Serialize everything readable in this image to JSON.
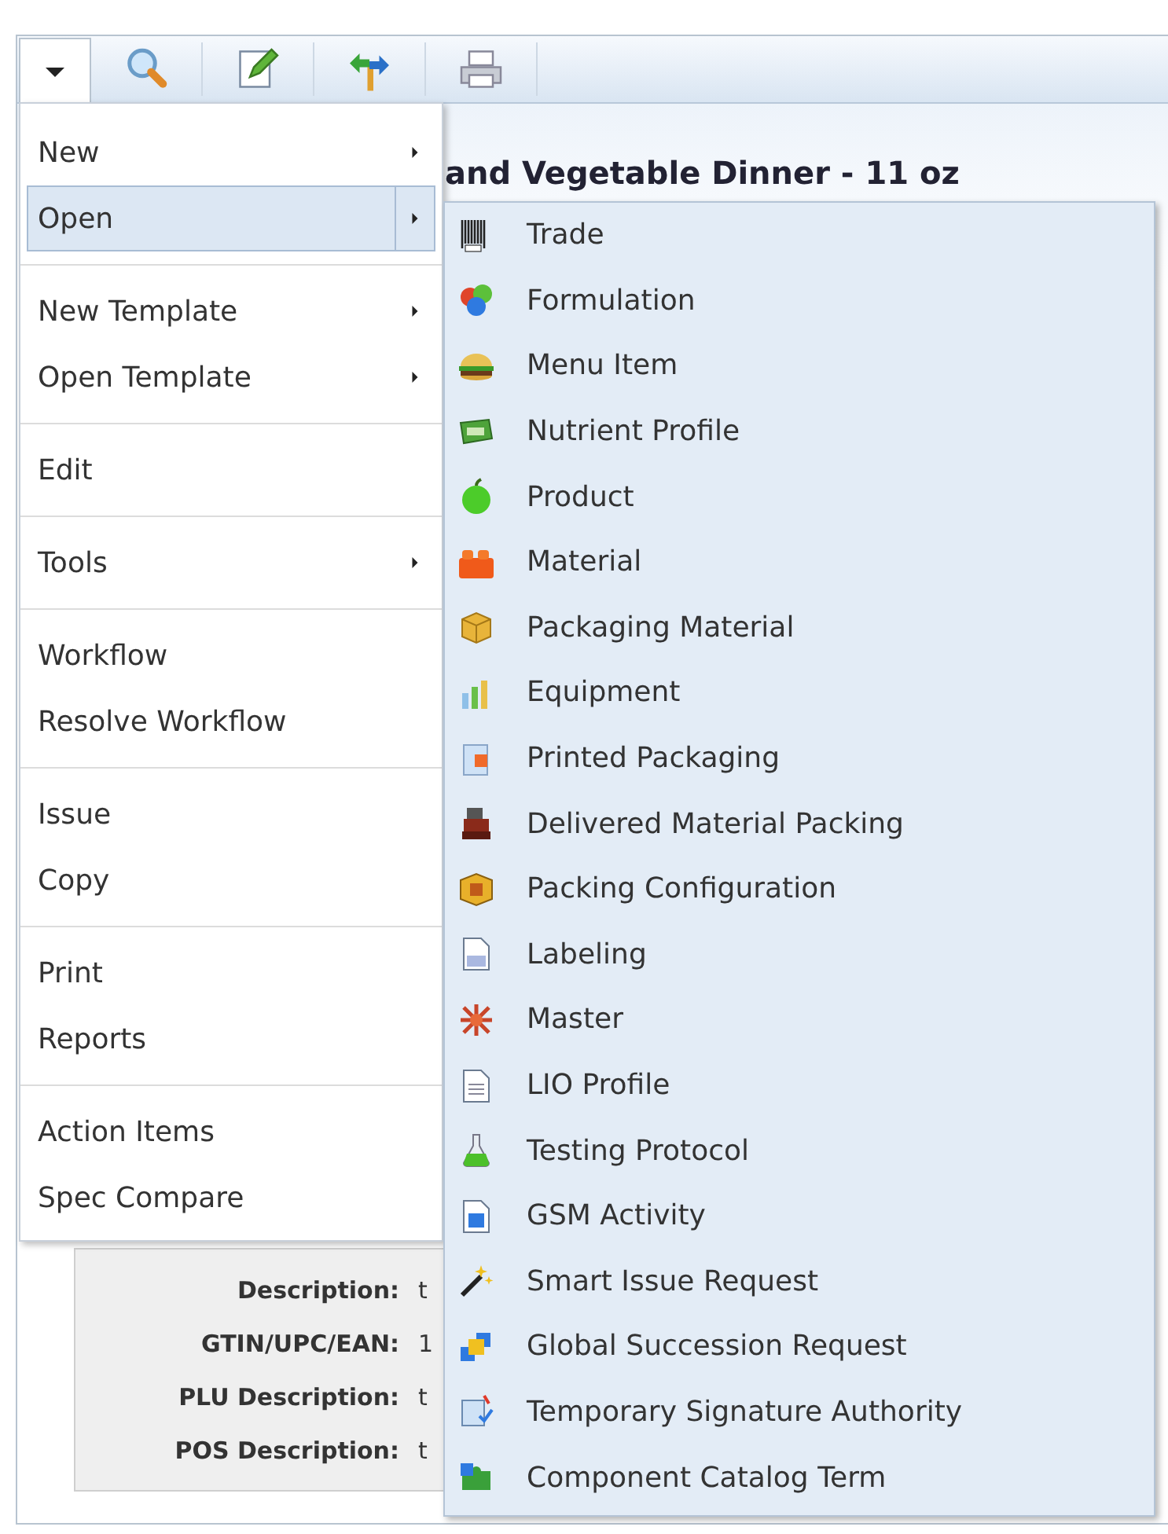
{
  "page": {
    "title": "and Vegetable Dinner - 11 oz",
    "fields": [
      {
        "label": "Description:",
        "value": "t"
      },
      {
        "label": "GTIN/UPC/EAN:",
        "value": "1"
      },
      {
        "label": "PLU Description:",
        "value": "t"
      },
      {
        "label": "POS Description:",
        "value": "t"
      }
    ]
  },
  "menu": {
    "items": [
      {
        "kind": "item",
        "label": "New",
        "submenu": true,
        "selected": false
      },
      {
        "kind": "item",
        "label": "Open",
        "submenu": true,
        "selected": true
      },
      {
        "kind": "separator"
      },
      {
        "kind": "item",
        "label": "New Template",
        "submenu": true,
        "selected": false
      },
      {
        "kind": "item",
        "label": "Open Template",
        "submenu": true,
        "selected": false
      },
      {
        "kind": "separator"
      },
      {
        "kind": "item",
        "label": "Edit",
        "submenu": false,
        "selected": false
      },
      {
        "kind": "separator"
      },
      {
        "kind": "item",
        "label": "Tools",
        "submenu": true,
        "selected": false
      },
      {
        "kind": "separator"
      },
      {
        "kind": "item",
        "label": "Workflow",
        "submenu": false,
        "selected": false
      },
      {
        "kind": "item",
        "label": "Resolve Workflow",
        "submenu": false,
        "selected": false
      },
      {
        "kind": "separator"
      },
      {
        "kind": "item",
        "label": "Issue",
        "submenu": false,
        "selected": false
      },
      {
        "kind": "item",
        "label": "Copy",
        "submenu": false,
        "selected": false
      },
      {
        "kind": "separator"
      },
      {
        "kind": "item",
        "label": "Print",
        "submenu": false,
        "selected": false
      },
      {
        "kind": "item",
        "label": "Reports",
        "submenu": false,
        "selected": false
      },
      {
        "kind": "separator"
      },
      {
        "kind": "item",
        "label": "Action Items",
        "submenu": false,
        "selected": false
      },
      {
        "kind": "item",
        "label": "Spec Compare",
        "submenu": false,
        "selected": false
      }
    ]
  },
  "submenu": {
    "items": [
      {
        "label": "Trade"
      },
      {
        "label": "Formulation"
      },
      {
        "label": "Menu Item"
      },
      {
        "label": "Nutrient Profile"
      },
      {
        "label": "Product"
      },
      {
        "label": "Material"
      },
      {
        "label": "Packaging Material"
      },
      {
        "label": "Equipment"
      },
      {
        "label": "Printed Packaging"
      },
      {
        "label": "Delivered Material Packing"
      },
      {
        "label": "Packing Configuration"
      },
      {
        "label": "Labeling"
      },
      {
        "label": "Master"
      },
      {
        "label": "LIO Profile"
      },
      {
        "label": "Testing Protocol"
      },
      {
        "label": "GSM Activity"
      },
      {
        "label": "Smart Issue Request"
      },
      {
        "label": "Global Succession Request"
      },
      {
        "label": "Temporary Signature Authority"
      },
      {
        "label": "Component Catalog Term"
      }
    ]
  }
}
